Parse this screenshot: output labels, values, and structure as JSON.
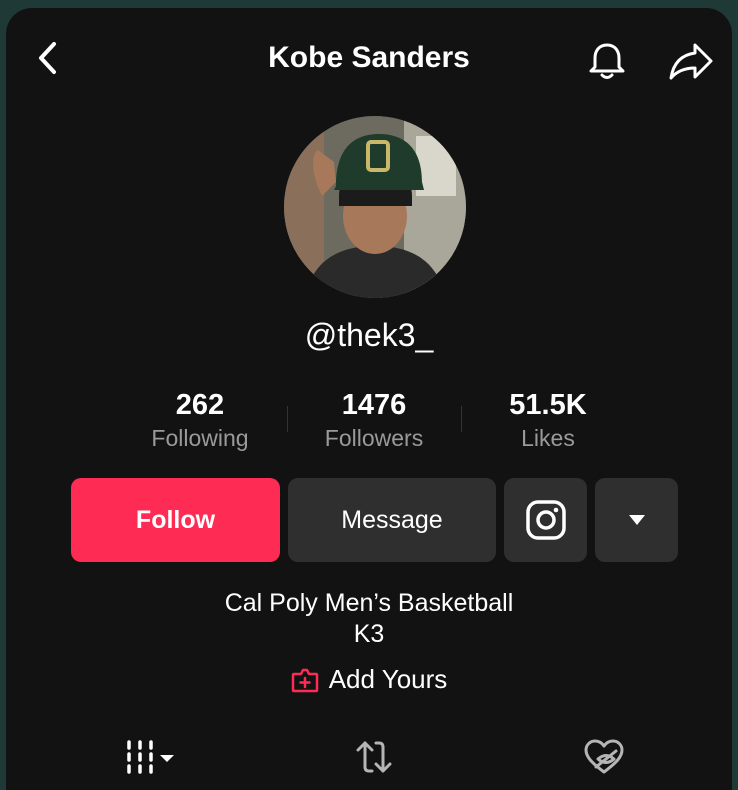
{
  "header": {
    "title": "Kobe Sanders",
    "back_icon": "chevron-left-icon",
    "bell_icon": "bell-icon",
    "share_icon": "share-arrow-icon"
  },
  "profile": {
    "handle": "@thek3_",
    "stats": [
      {
        "value": "262",
        "label": "Following"
      },
      {
        "value": "1476",
        "label": "Followers"
      },
      {
        "value": "51.5K",
        "label": "Likes"
      }
    ]
  },
  "actions": {
    "follow_label": "Follow",
    "message_label": "Message",
    "instagram_icon": "instagram-icon",
    "more_icon": "caret-down-icon"
  },
  "bio": {
    "line1": "Cal Poly Men’s Basketball",
    "line2": "K3"
  },
  "add_yours": {
    "label": "Add Yours",
    "icon": "add-yours-icon"
  },
  "tabs": [
    {
      "name": "videos",
      "icon": "grid-icon"
    },
    {
      "name": "reposts",
      "icon": "repost-icon"
    },
    {
      "name": "liked",
      "icon": "hidden-heart-icon"
    }
  ],
  "colors": {
    "accent": "#fe2c55",
    "background": "#121212",
    "button": "#2f2f2f",
    "muted_text": "#9a9a9a"
  }
}
